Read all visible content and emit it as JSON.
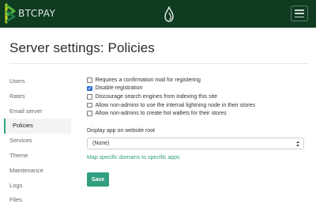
{
  "header": {
    "brand_text": "BTCPAY",
    "brand_color": "#0f3b21",
    "accent_color": "#329f80",
    "menu_icon": "hamburger-icon",
    "center_icon": "btcpay-drop-icon"
  },
  "page": {
    "title": "Server settings: Policies"
  },
  "sidebar": {
    "items": [
      {
        "label": "Users",
        "active": false
      },
      {
        "label": "Rates",
        "active": false
      },
      {
        "label": "Email server",
        "active": false
      },
      {
        "label": "Policies",
        "active": true
      },
      {
        "label": "Services",
        "active": false
      },
      {
        "label": "Theme",
        "active": false
      },
      {
        "label": "Maintenance",
        "active": false
      },
      {
        "label": "Logs",
        "active": false
      },
      {
        "label": "Files",
        "active": false
      }
    ]
  },
  "policies": {
    "options": [
      {
        "label": "Requires a confirmation mail for registering",
        "checked": false
      },
      {
        "label": "Disable registration",
        "checked": true
      },
      {
        "label": "Discourage search engines from indexing this site",
        "checked": false
      },
      {
        "label": "Allow non-admins to use the internal lightning node in their stores",
        "checked": false
      },
      {
        "label": "Allow non-admins to create hot wallets for their stores",
        "checked": false
      }
    ],
    "display_app_label": "Display app on website root",
    "display_app_value": "(None)",
    "map_domains_link": "Map specific domains to specific apps",
    "save_label": "Save"
  }
}
